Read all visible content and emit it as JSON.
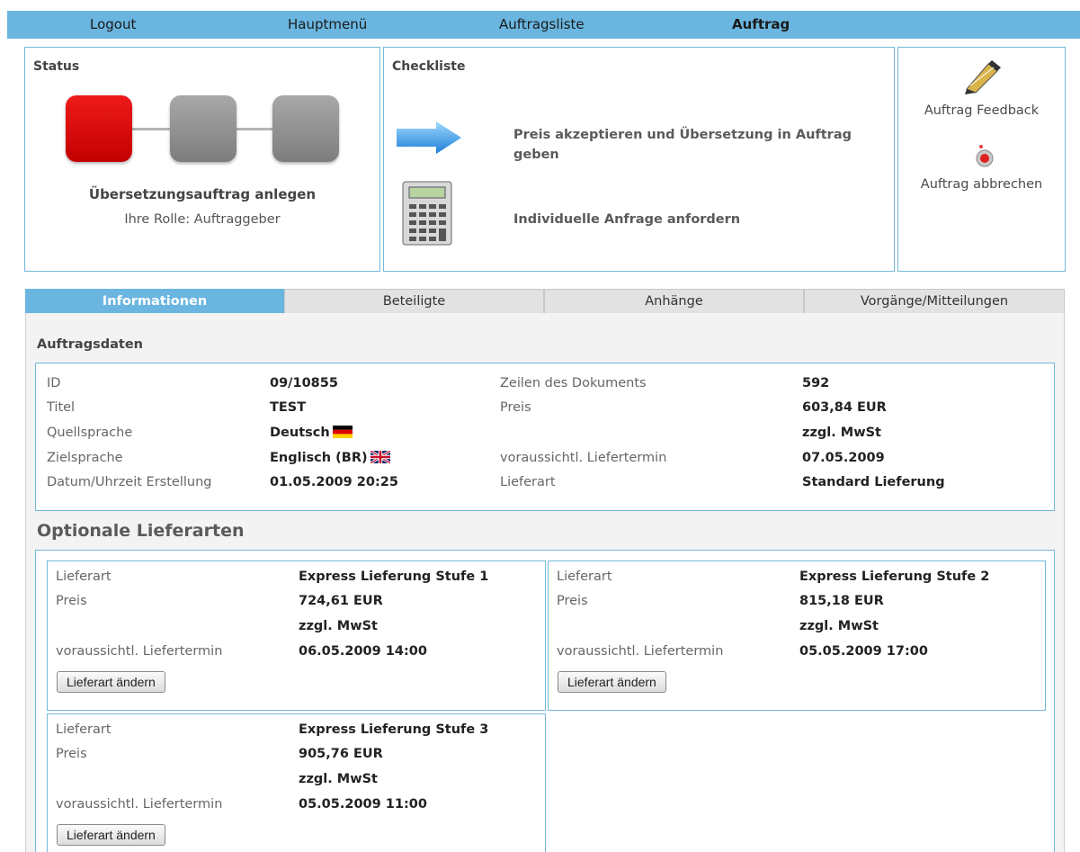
{
  "nav": {
    "logout": "Logout",
    "main_menu": "Hauptmenü",
    "order_list": "Auftragsliste",
    "order": "Auftrag"
  },
  "status": {
    "title": "Status",
    "step_label": "Übersetzungsauftrag anlegen",
    "role": "Ihre Rolle: Auftraggeber"
  },
  "checklist": {
    "title": "Checkliste",
    "items": [
      {
        "label": "Preis akzeptieren und Übersetzung in Auftrag geben",
        "icon": "arrow-icon"
      },
      {
        "label": "Individuelle Anfrage anfordern",
        "icon": "calculator-icon"
      }
    ]
  },
  "actions": {
    "feedback": "Auftrag Feedback",
    "cancel": "Auftrag abbrechen"
  },
  "tabs": [
    "Informationen",
    "Beteiligte",
    "Anhänge",
    "Vorgänge/Mitteilungen"
  ],
  "order_data": {
    "heading": "Auftragsdaten",
    "left": [
      {
        "label": "ID",
        "value": "09/10855"
      },
      {
        "label": "Titel",
        "value": "TEST"
      },
      {
        "label": "Quellsprache",
        "value": "Deutsch"
      },
      {
        "label": "Zielsprache",
        "value": "Englisch (BR)"
      },
      {
        "label": "Datum/Uhrzeit Erstellung",
        "value": "01.05.2009 20:25"
      }
    ],
    "right": [
      {
        "label": "Zeilen des Dokuments",
        "value": "592"
      },
      {
        "label": "Preis",
        "value": "603,84 EUR"
      },
      {
        "label": "",
        "value": "zzgl. MwSt"
      },
      {
        "label": "voraussichtl. Liefertermin",
        "value": "07.05.2009"
      },
      {
        "label": "Lieferart",
        "value": "Standard Lieferung"
      }
    ]
  },
  "optional": {
    "heading": "Optionale Lieferarten",
    "labels": {
      "type": "Lieferart",
      "price": "Preis",
      "date": "voraussichtl. Liefertermin"
    },
    "button": "Lieferart ändern",
    "options": [
      {
        "type": "Express Lieferung Stufe 1",
        "price": "724,61 EUR",
        "tax": "zzgl. MwSt",
        "date": "06.05.2009 14:00"
      },
      {
        "type": "Express Lieferung Stufe 2",
        "price": "815,18 EUR",
        "tax": "zzgl. MwSt",
        "date": "05.05.2009 17:00"
      },
      {
        "type": "Express Lieferung Stufe 3",
        "price": "905,76 EUR",
        "tax": "zzgl. MwSt",
        "date": "05.05.2009 11:00"
      }
    ]
  },
  "colors": {
    "accent": "#6ab6e0",
    "border": "#74b9d9",
    "status_active": "#e00000",
    "status_inactive": "#8e8e8e"
  }
}
